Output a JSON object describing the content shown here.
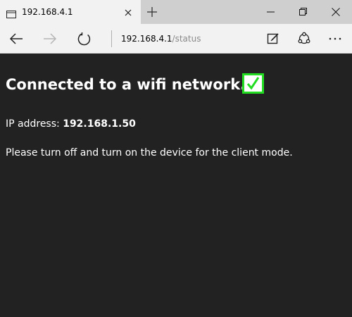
{
  "browser": {
    "tab": {
      "title": "192.168.4.1"
    },
    "address_bar": {
      "host": "192.168.4.1",
      "path": "/status"
    }
  },
  "page": {
    "heading": "Connected to a wifi network.",
    "status_check": true,
    "ip_label": "IP address: ",
    "ip_value": "192.168.1.50",
    "instruction": "Please turn off and turn on the device for the client mode."
  },
  "colors": {
    "page_background": "#222222",
    "checkbox_border": "#22dd22",
    "text": "#ffffff"
  }
}
